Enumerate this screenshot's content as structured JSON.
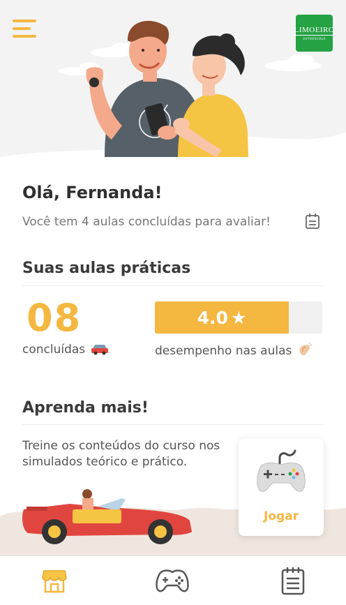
{
  "header": {
    "menu_icon": "hamburger-menu-icon",
    "logo_text": "LIMOEIRO",
    "logo_subtext": "AUTOESCOLA",
    "logo_color": "#25a244"
  },
  "greeting": {
    "title": "Olá, Fernanda!",
    "subtitle": "Você tem 4 aulas concluídas para avaliar!",
    "subtitle_icon": "calendar-icon"
  },
  "practical": {
    "title": "Suas aulas práticas",
    "completed_count": "08",
    "completed_label": "concluídas",
    "completed_icon": "car-icon",
    "rating_value": "4.0",
    "rating_fraction": 0.8,
    "rating_label": "desempenho nas aulas",
    "rating_icon": "clapping-hands-icon"
  },
  "learn": {
    "title": "Aprenda mais!",
    "text": "Treine os conteúdos do curso nos simulados teórico e prático.",
    "play_label": "Jogar",
    "play_icon": "gamepad-icon"
  },
  "tabbar": {
    "tabs": [
      {
        "icon": "store-icon",
        "active": true
      },
      {
        "icon": "gamepad-icon",
        "active": false
      },
      {
        "icon": "notepad-icon",
        "active": false
      }
    ]
  },
  "colors": {
    "accent": "#f4b740",
    "text": "#3a3a3a",
    "muted": "#777777"
  }
}
